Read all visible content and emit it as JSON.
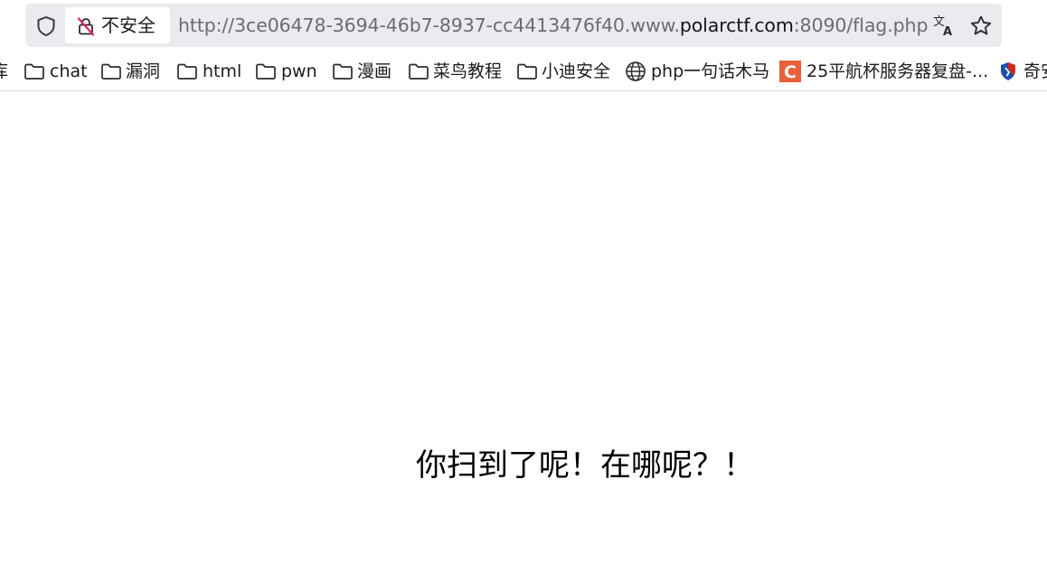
{
  "browser": {
    "security_label": "不安全",
    "url": {
      "prefix": "http://3ce06478-3694-46b7-8937-cc4413476f40.www.",
      "domain": "polarctf.com",
      "suffix": ":8090/flag.php"
    }
  },
  "bookmarks": {
    "items": [
      {
        "label": "库",
        "icon": "folder-icon"
      },
      {
        "label": "chat",
        "icon": "folder-icon"
      },
      {
        "label": "漏洞",
        "icon": "folder-icon"
      },
      {
        "label": "html",
        "icon": "folder-icon"
      },
      {
        "label": "pwn",
        "icon": "folder-icon"
      },
      {
        "label": "漫画",
        "icon": "folder-icon"
      },
      {
        "label": "菜鸟教程",
        "icon": "folder-icon"
      },
      {
        "label": "小迪安全",
        "icon": "folder-icon"
      },
      {
        "label": "php一句话木马",
        "icon": "globe-icon"
      },
      {
        "label": "25平航杯服务器复盘-...",
        "icon": "csdn-icon"
      },
      {
        "label": "奇安",
        "icon": "qianxin-icon"
      }
    ]
  },
  "page": {
    "message": "你扫到了呢！在哪呢？！"
  },
  "colors": {
    "urlbar_bg": "#ebebef",
    "warning_slash": "#e22850",
    "csdn_badge": "#e8613a",
    "qianxin_red": "#d7261e",
    "qianxin_blue": "#1d4fa8"
  }
}
